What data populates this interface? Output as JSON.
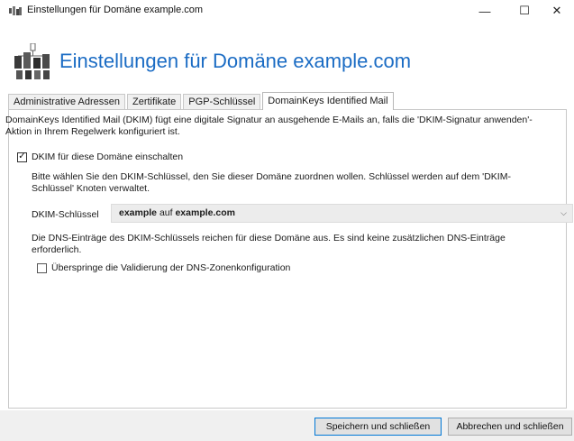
{
  "window": {
    "title": "Einstellungen für Domäne example.com",
    "minimize": "—",
    "maximize": "☐",
    "close": "✕"
  },
  "header": {
    "title": "Einstellungen für Domäne example.com",
    "icon": "domain-network-icon",
    "title_color": "#1b6cc4"
  },
  "tabs": [
    {
      "label": "Administrative Adressen"
    },
    {
      "label": "Zertifikate"
    },
    {
      "label": "PGP-Schlüssel"
    },
    {
      "label": "DomainKeys Identified Mail"
    }
  ],
  "dkim": {
    "description": "DomainKeys Identified Mail (DKIM) fügt eine digitale Signatur an ausgehende E-Mails an, falls die 'DKIM-Signatur anwenden'-Aktion in Ihrem Regelwerk konfiguriert ist.",
    "enable_label": "DKIM für diese Domäne einschalten",
    "enable_checked": true,
    "select_hint": "Bitte wählen Sie den DKIM-Schlüssel, den Sie dieser Domäne zuordnen wollen. Schlüssel werden auf dem 'DKIM-Schlüssel' Knoten verwaltet.",
    "key_label": "DKIM-Schlüssel",
    "key_value_name": "example",
    "key_value_mid": " auf ",
    "key_value_domain": "example.com",
    "dns_info": "Die DNS-Einträge des DKIM-Schlüssels reichen für diese Domäne aus. Es sind keine zusätzlichen DNS-Einträge erforderlich.",
    "skip_label": "Überspringe die Validierung der DNS-Zonenkonfiguration",
    "skip_checked": false
  },
  "footer": {
    "save_label": "Speichern und schließen",
    "cancel_label": "Abbrechen und schließen"
  }
}
